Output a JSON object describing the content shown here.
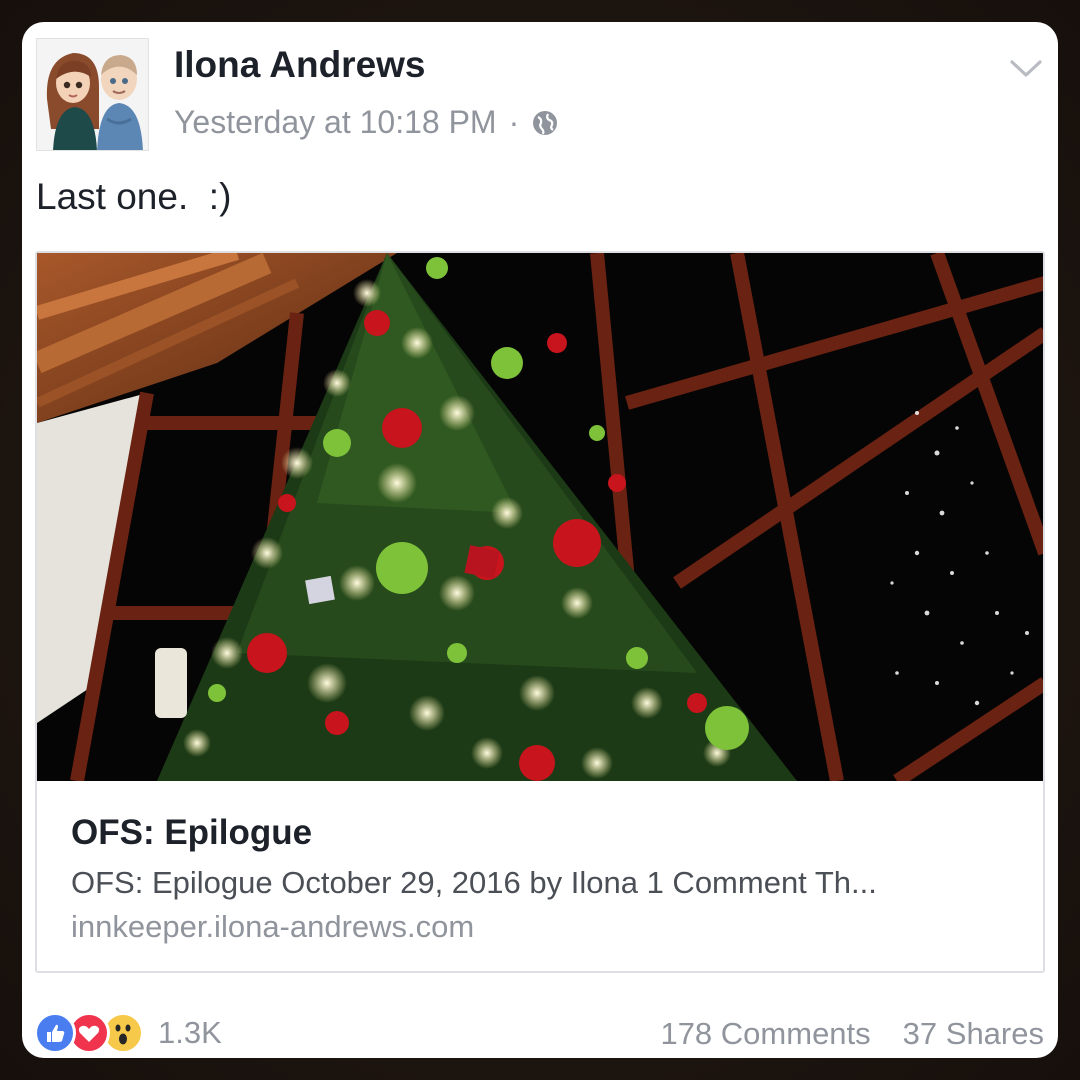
{
  "post": {
    "author": "Ilona Andrews",
    "timestamp": "Yesterday at 10:18 PM",
    "separator": "·",
    "privacy_icon": "globe-icon",
    "menu_icon": "chevron-down-icon",
    "text": "Last one.  :)"
  },
  "link_preview": {
    "title": "OFS: Epilogue",
    "description": "OFS: Epilogue October 29, 2016 by Ilona 1 Comment Th...",
    "domain": "innkeeper.ilona-andrews.com"
  },
  "engagement": {
    "reaction_icons": [
      "like-icon",
      "love-icon",
      "wow-icon"
    ],
    "reaction_count": "1.3K",
    "comments": "178 Comments",
    "shares": "37 Shares"
  },
  "colors": {
    "like": "#4a7df0",
    "love": "#f0344e",
    "wow": "#f7c94a",
    "text_primary": "#1d2129",
    "text_secondary": "#90949c"
  }
}
